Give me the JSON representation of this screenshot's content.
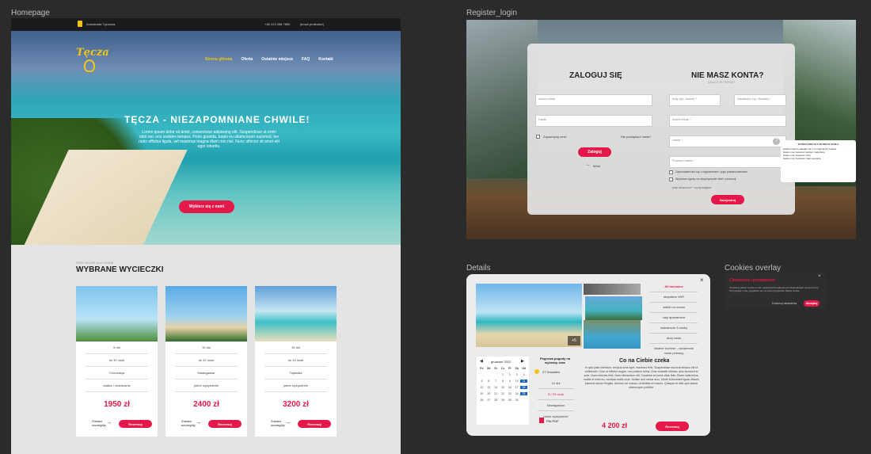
{
  "frames": {
    "home": "Homepage",
    "register": "Register_login",
    "details": "Details",
    "cookies": "Cookies overlay"
  },
  "home": {
    "topbar": {
      "left": "Autostrada Tęczowa",
      "phone": "+48 123 456 7890",
      "email": "[email protected]"
    },
    "logo": "Tęcza",
    "nav": [
      "Strona główna",
      "Oferta",
      "Ostatnie miejsca",
      "FAQ",
      "Kontakt"
    ],
    "hero_title": "TĘCZA - NIEZAPOMNIANE CHWILE!",
    "hero_text": "Lorem ipsum dolor sit amet, consectetur adipiscing elit. Suspendisse ut enim odio nec orci sodales tempus. Proin gravida, turpis eu ullamcorper euismod, leo nunc efficitur ligula, vel maximus magna diam non nisl. Nunc ultrices sit amet elit eget lobortis.",
    "hero_button": "Wybierz się z nami",
    "section_kicker": "SPECJALNIE DLA CIEBIE",
    "section_title": "WYBRANE WYCIECZKI",
    "cards": [
      {
        "rows": [
          "5 dni",
          "do 30 osób",
          "Chorwacja",
          "wiatka / zwiedzanie"
        ],
        "price": "1950 zł",
        "see": "Zobacz szczegóły",
        "btn": "Rezerwuj"
      },
      {
        "rows": [
          "10 dni",
          "do 20 osób",
          "Madagaskar",
          "pełne wyżywienie"
        ],
        "price": "2400 zł",
        "see": "Zobacz szczegóły",
        "btn": "Rezerwuj"
      },
      {
        "rows": [
          "15 dni",
          "do 15 osób",
          "Tajlandia",
          "pełne wyżywienie"
        ],
        "price": "3200 zł",
        "see": "Zobacz szczegóły",
        "btn": "Rezerwuj"
      }
    ]
  },
  "register": {
    "login_title": "ZALOGUJ SIĘ",
    "login_email": "Adres email",
    "login_pass": "Hasło",
    "remember": "Zapamiętaj mnie",
    "forgot": "Nie pamiętasz hasła?",
    "login_btn": "Zaloguj",
    "back": "Wróć",
    "reg_title": "NIE MASZ KONTA?",
    "reg_sub": "ZAŁÓŻ JE TERAZ!",
    "first": "Imię (np. Adam) *",
    "last": "Nazwisko (np. Nowak) *",
    "email": "Adres email *",
    "pass": "Hasło *",
    "repeat": "Powtórz hasło *",
    "check1": "Zapoznałem/am się z regulaminem i jego postanowieniami",
    "check2": "Wyrażam zgodę na otrzymywanie ofert i promocji",
    "note": "pola oznaczone * są wymagane",
    "reg_btn": "Zarejestruj",
    "tip_title": "WYMAGANIA DLA SILNEGO HASŁA",
    "tips": [
      "Hasło powinno składać się z co najmniej 8 znaków",
      "Hasło musi zawierać wielką i małą literę",
      "Hasło musi zawierać cyfrę",
      "Hasło musi zawierać znak specjalny"
    ]
  },
  "details": {
    "plus": "+5",
    "features": [
      "All inclusive",
      "bezpłatne WiFi",
      "widok na ocean",
      "cały apartament",
      "maksimum 3 osoby",
      "duży taras",
      "lokalne kuchnie - codziennie nowe potrawy"
    ],
    "month": "grudzień 2022",
    "days": [
      "Pn",
      "Wt",
      "Śr",
      "Cz",
      "Pt",
      "Sb",
      "Nd"
    ],
    "dates": [
      "",
      "",
      "",
      "1",
      "2",
      "3",
      "4",
      "5",
      "6",
      "7",
      "8",
      "9",
      "10",
      "11",
      "12",
      "13",
      "14",
      "15",
      "16",
      "17",
      "18",
      "19",
      "20",
      "21",
      "22",
      "23",
      "24",
      "25",
      "26",
      "27",
      "28",
      "29",
      "30",
      "31"
    ],
    "sel_title": "Pogrowa pogody na wybrany czas",
    "sel_date": "27 Grudzień",
    "info": [
      "10 dni",
      "5 / 20 osób",
      "Madagaskar",
      "pełne wyżywienie"
    ],
    "pdf": "Plik PDF",
    "desc_title": "Co na Ciebie czeka",
    "desc": "In quis justo interdum, tempus urna eget, maximus felis. Suspendisse nisi erat tempus elit ut sollicitudin. Cras ut efficitur augue, non pretium tellus. Duis molestie ultrices, quis tincidunt et ante. Nunc ultricies felis. Nam elementum elit. Curabitur at purus vitae felis. Etiam nulla tellus, mattis id enim eu, volutpat mollis urna. Nullam sed varius arcu. Morbi id tincidunt ligula. Mauris placerat auctor fringilla. Aenean vel massa, ut facilisis et mauris. Quisque et nibh quis ipsum ullamcorper porttitor.",
    "price": "4 200 zł",
    "btn": "Rezerwuj"
  },
  "cookies": {
    "title": "Ciasteczka i prywatność",
    "text": "Używamy plików cookie w celu zapewnienia najlepszej funkcjonalności naszej strony. Korzystając z niej, zgadzasz się na wykorzystywanie plików cookie.",
    "link": "Dostosuj ustawienia",
    "btn": "Akceptuj"
  }
}
